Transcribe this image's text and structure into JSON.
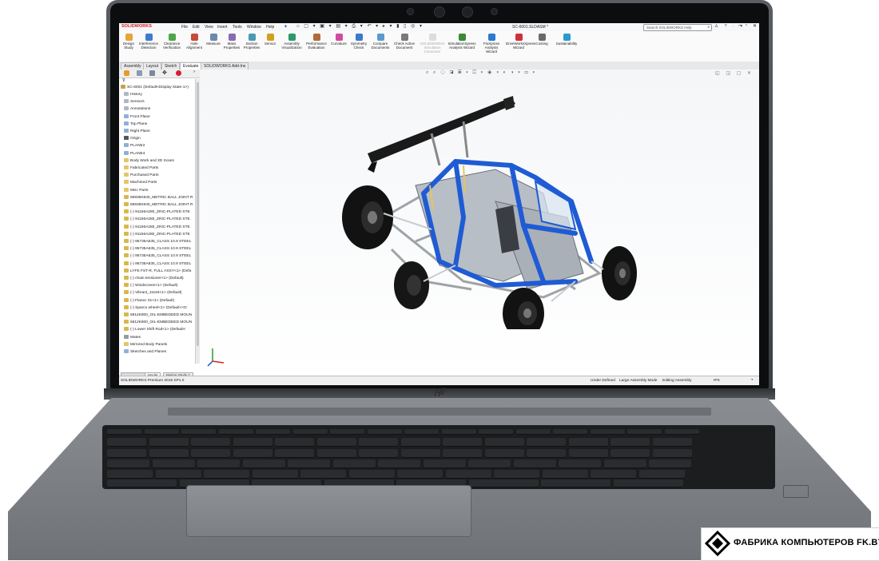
{
  "window": {
    "app_logo": "SOLIDWORKS",
    "title": "SC-6001.SLDASM *",
    "search_placeholder": "Search SOLIDWORKS Help"
  },
  "menu": [
    "File",
    "Edit",
    "View",
    "Insert",
    "Tools",
    "Window",
    "Help"
  ],
  "ribbon_tools": [
    {
      "label": "Design Study",
      "icon": "design-study-icon"
    },
    {
      "label": "Interference Detection",
      "icon": "interference-icon"
    },
    {
      "label": "Clearance Verification",
      "icon": "clearance-icon"
    },
    {
      "label": "Hole Alignment",
      "icon": "hole-alignment-icon"
    },
    {
      "label": "Measure",
      "icon": "measure-icon"
    },
    {
      "label": "Mass Properties",
      "icon": "mass-properties-icon"
    },
    {
      "label": "Section Properties",
      "icon": "section-properties-icon"
    },
    {
      "label": "Sensor",
      "icon": "sensor-icon"
    },
    {
      "label": "Assembly Visualization",
      "icon": "assembly-visualization-icon"
    },
    {
      "label": "Performance Evaluation",
      "icon": "performance-icon"
    },
    {
      "label": "Curvature",
      "icon": "curvature-icon"
    },
    {
      "label": "Symmetry Check",
      "icon": "symmetry-icon"
    },
    {
      "label": "Compare Documents",
      "icon": "compare-icon"
    },
    {
      "label": "Check Active Document",
      "icon": "check-document-icon"
    },
    {
      "label": "SOLIDWORKS Simulation Connector",
      "icon": "simulation-connector-icon"
    },
    {
      "label": "SimulationXpress Analysis Wizard",
      "icon": "simulationxpress-icon"
    },
    {
      "label": "FloXpress Analysis Wizard",
      "icon": "floxpress-icon"
    },
    {
      "label": "DriveWorksXpress Wizard",
      "icon": "driveworks-icon"
    },
    {
      "label": "Costing",
      "icon": "costing-icon"
    },
    {
      "label": "Sustainability",
      "icon": "sustainability-icon"
    }
  ],
  "command_tabs": [
    "Assembly",
    "Layout",
    "Sketch",
    "Evaluate",
    "SOLIDWORKS Add-Ins"
  ],
  "active_tab": "Evaluate",
  "tree": {
    "root": "SC-6001 (Default<Display State-1>)",
    "items": [
      "History",
      "Sensors",
      "Annotations",
      "Front Plane",
      "Top Plane",
      "Right Plane",
      "Origin",
      "PLANE2",
      "PLANE4",
      "Body Work and 3D Scans",
      "Fabricated Parts",
      "Purchased Parts",
      "Machined Parts",
      "Misc Parts",
      "59935K840_METRIC BALL JOINT R",
      "59935K840_METRIC BALL JOINT R",
      "(-) 91166A280_ZINC-PLATED STE",
      "(-) 91166A280_ZINC-PLATED STE",
      "(-) 91166A280_ZINC-PLATED STE",
      "(-) 91166A280_ZINC-PLATED STE",
      "(-) 95735A635_CLASS 10.9 STEEL",
      "(-) 95735A635_CLASS 10.9 STEEL",
      "(-) 95735A635_CLASS 10.9 STEEL",
      "(-) 95735A635_CLASS 10.9 STEEL",
      "LYFE FST-R, FULL ASSY<1> (Defa",
      "(-) chain tensioner<1> (Default)",
      "(-) Windscreen<1> (Default)",
      "(-) Vibrant_11164<1> (Default)",
      "(-) Flanec 01<1> (Default)",
      "(-) Sparco wheel<1> (Default<<D",
      "5912K800_OIL-EMBEDDED MOUN",
      "5912K800_OIL-EMBEDDED MOUN",
      "(-) Lower Shift Rod<1> (Default<",
      "Mates",
      "Mirrored Body Panels",
      "Sketches and Planes"
    ]
  },
  "bottom_tabs": [
    "Model",
    "Motion Study 1"
  ],
  "status": {
    "left": "SOLIDWORKS Premium 2019 SP1.0",
    "items": [
      "Under Defined",
      "Large Assembly Mode",
      "Editing Assembly",
      "IPS"
    ]
  },
  "watermark": "ФАБРИКА КОМПЬЮТЕРОВ FK.BY",
  "colors": {
    "frame_blue": "#1f5bd4",
    "solidworks_red": "#d2202f",
    "laptop_gray": "#7e8185"
  }
}
